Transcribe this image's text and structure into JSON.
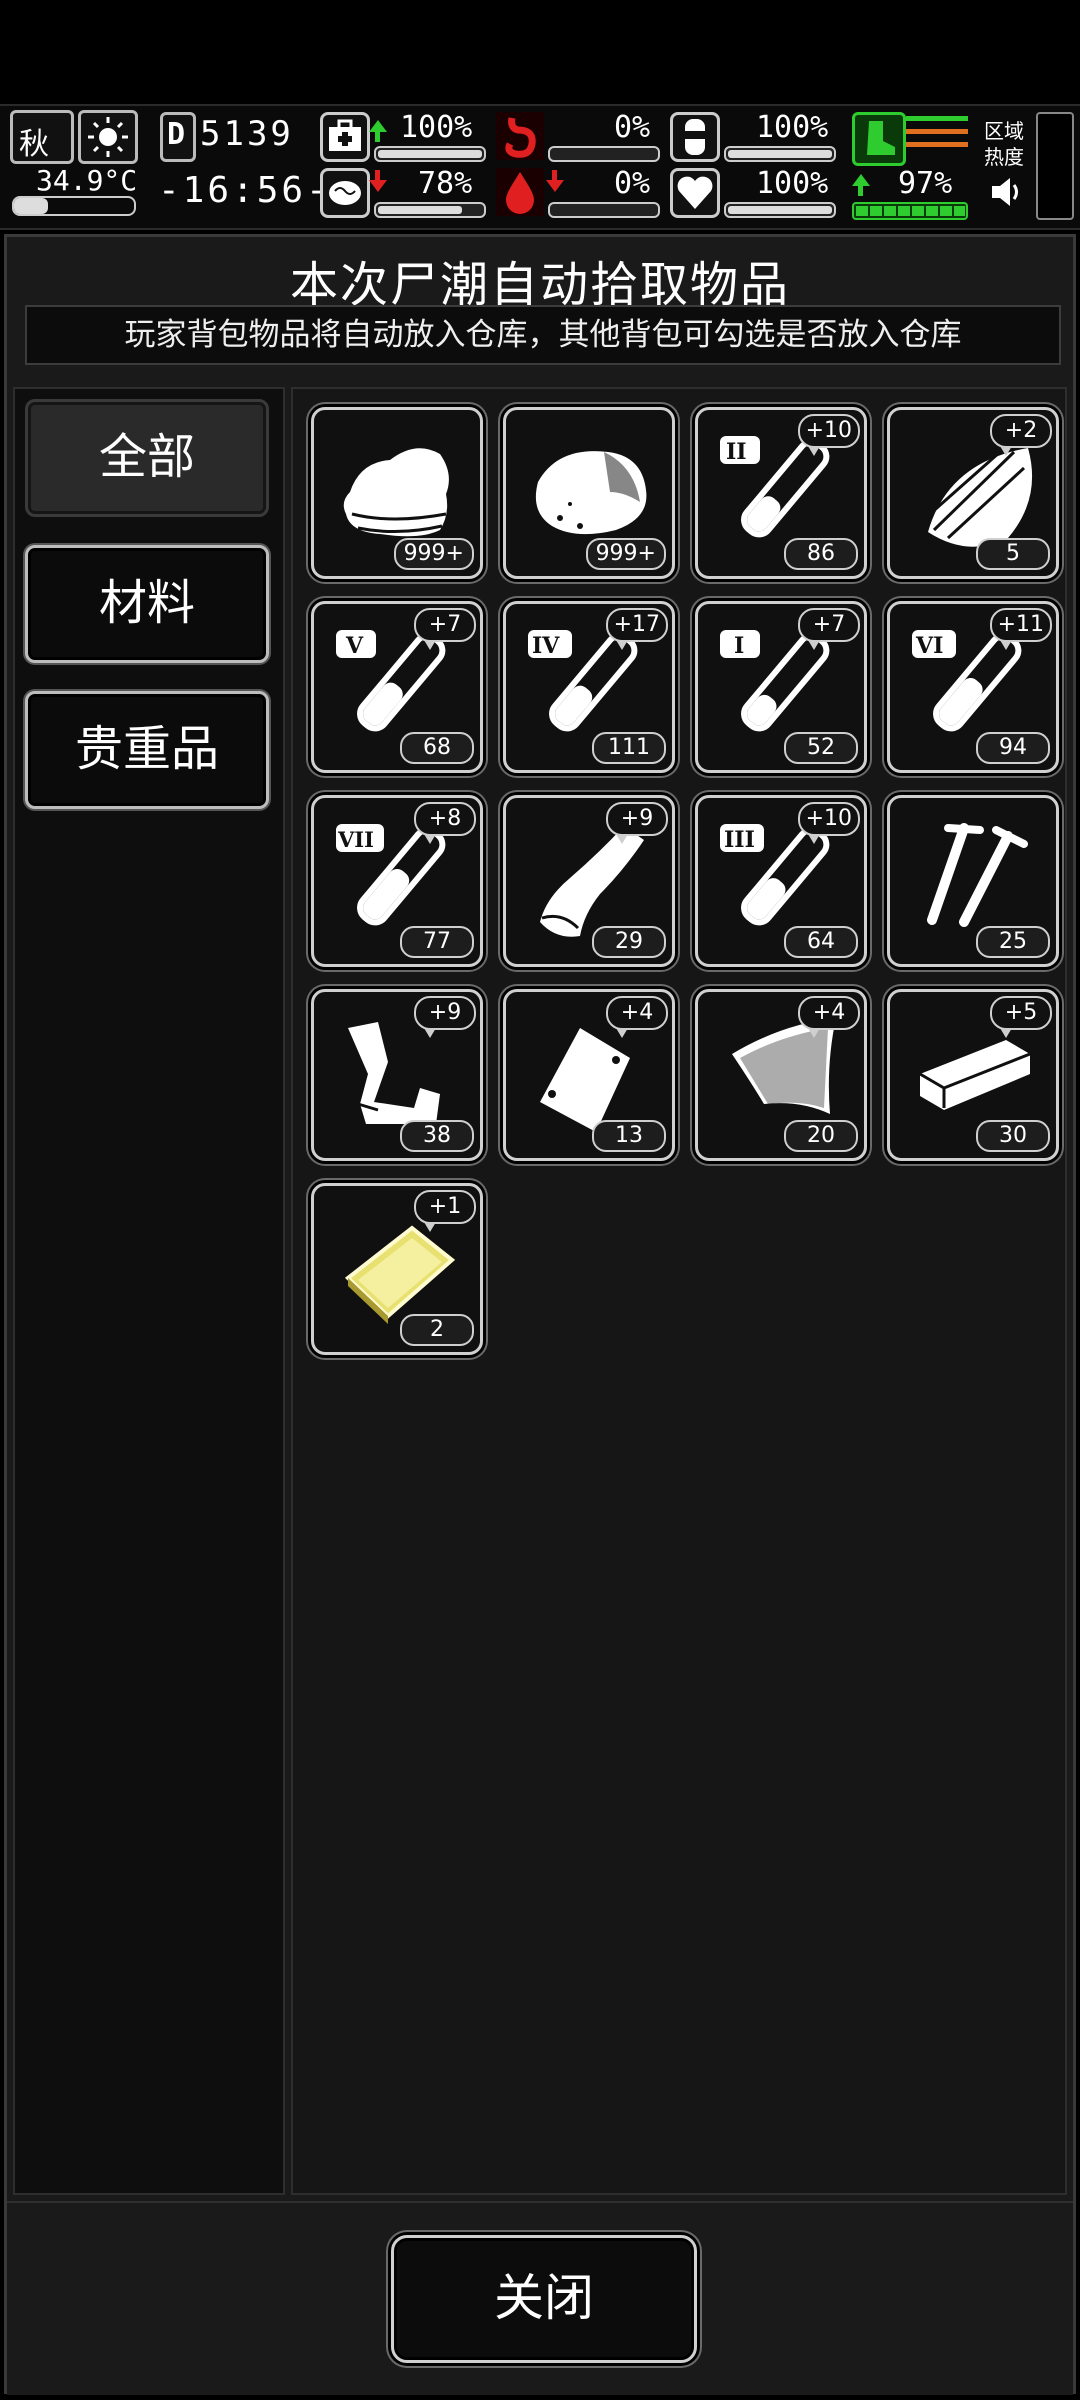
{
  "hud": {
    "season": "秋",
    "temperature": "34.9°C",
    "day": "5139",
    "time": "-16:56-",
    "stats": [
      {
        "name": "health",
        "value": "100%",
        "trend": "up",
        "level": 1.0
      },
      {
        "name": "hunger",
        "value": "0%",
        "trend": "none",
        "level": 0.0
      },
      {
        "name": "thirst",
        "value": "100%",
        "trend": "none",
        "level": 1.0
      },
      {
        "name": "sanity",
        "value": "78%",
        "trend": "down",
        "level": 0.78
      },
      {
        "name": "bleeding",
        "value": "0%",
        "trend": "down",
        "level": 0.0
      },
      {
        "name": "mood",
        "value": "100%",
        "trend": "none",
        "level": 1.0
      },
      {
        "name": "stamina",
        "value": "97%",
        "trend": "up",
        "level": 0.97
      }
    ],
    "zone_heat_label": "区域\n热度"
  },
  "panel": {
    "title": "本次尸潮自动拾取物品",
    "subtitle": "玩家背包物品将自动放入仓库，其他背包可勾选是否放入仓库"
  },
  "categories": [
    {
      "label": "全部",
      "active": true
    },
    {
      "label": "材料",
      "active": false
    },
    {
      "label": "贵重品",
      "active": false
    }
  ],
  "items": [
    {
      "icon": "cloth-icon",
      "count": "999+",
      "plus": ""
    },
    {
      "icon": "meat-icon",
      "count": "999+",
      "plus": ""
    },
    {
      "icon": "test-tube-ii-icon",
      "count": "86",
      "plus": "+10",
      "roman": "II"
    },
    {
      "icon": "wood-chips-icon",
      "count": "5",
      "plus": "+2"
    },
    {
      "icon": "test-tube-v-icon",
      "count": "68",
      "plus": "+7",
      "roman": "V"
    },
    {
      "icon": "test-tube-iv-icon",
      "count": "111",
      "plus": "+17",
      "roman": "IV"
    },
    {
      "icon": "test-tube-i-icon",
      "count": "52",
      "plus": "+7",
      "roman": "I"
    },
    {
      "icon": "test-tube-vi-icon",
      "count": "94",
      "plus": "+11",
      "roman": "VI"
    },
    {
      "icon": "test-tube-vii-icon",
      "count": "77",
      "plus": "+8",
      "roman": "VII"
    },
    {
      "icon": "leather-icon",
      "count": "29",
      "plus": "+9"
    },
    {
      "icon": "test-tube-iii-icon",
      "count": "64",
      "plus": "+10",
      "roman": "III"
    },
    {
      "icon": "screws-icon",
      "count": "25",
      "plus": ""
    },
    {
      "icon": "scrap-metal-icon",
      "count": "38",
      "plus": "+9"
    },
    {
      "icon": "plastic-bag-icon",
      "count": "13",
      "plus": "+4"
    },
    {
      "icon": "glass-icon",
      "count": "20",
      "plus": "+4"
    },
    {
      "icon": "wood-plank-icon",
      "count": "30",
      "plus": "+5"
    },
    {
      "icon": "gold-bar-icon",
      "count": "2",
      "plus": "+1"
    }
  ],
  "close_label": "关闭",
  "colors": {
    "green": "#2ecc2e",
    "red": "#e02020",
    "orange": "#e07020",
    "gold": "#e8e070"
  }
}
